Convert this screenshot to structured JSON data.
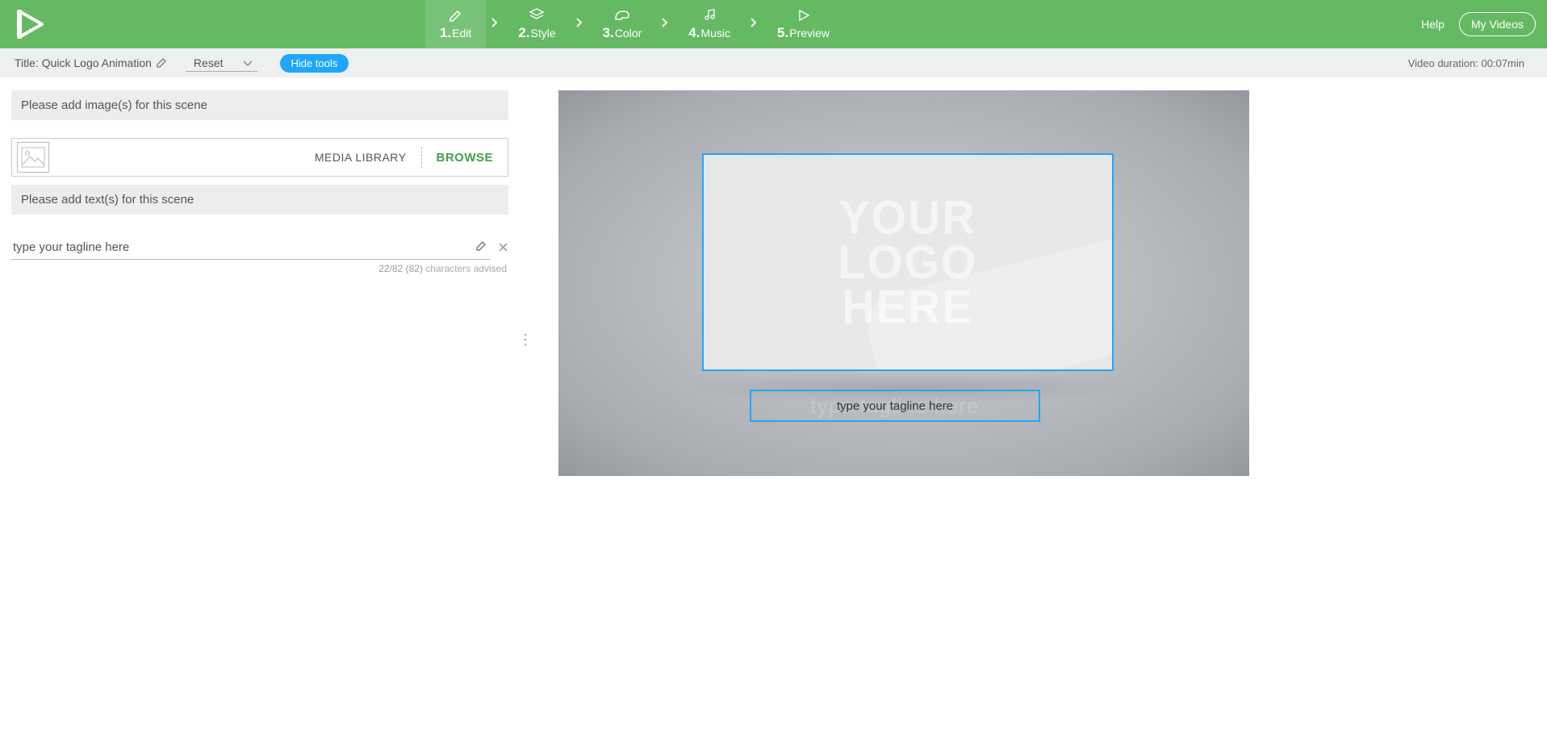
{
  "header": {
    "steps": [
      {
        "num": "1.",
        "label": "Edit",
        "active": true
      },
      {
        "num": "2.",
        "label": "Style",
        "active": false
      },
      {
        "num": "3.",
        "label": "Color",
        "active": false
      },
      {
        "num": "4.",
        "label": "Music",
        "active": false
      },
      {
        "num": "5.",
        "label": "Preview",
        "active": false
      }
    ],
    "help": "Help",
    "my_videos": "My Videos"
  },
  "subheader": {
    "title_prefix": "Title: ",
    "title": "Quick Logo Animation",
    "reset": "Reset",
    "hide_tools": "Hide tools",
    "duration": "Video duration: 00:07min"
  },
  "editor": {
    "add_images_label": "Please add image(s) for this scene",
    "media_library": "MEDIA LIBRARY",
    "browse": "BROWSE",
    "add_texts_label": "Please add text(s) for this scene",
    "tagline_value": "type your tagline here",
    "tagline_placeholder": "type your tagline here",
    "char_count": "22/82 (82)",
    "char_label": " characters advised"
  },
  "preview": {
    "logo_line1": "YOUR",
    "logo_line2": "LOGO",
    "logo_line3": "HERE",
    "bg_tagline": "type tagline here",
    "overlay_tagline": "type your tagline here"
  }
}
